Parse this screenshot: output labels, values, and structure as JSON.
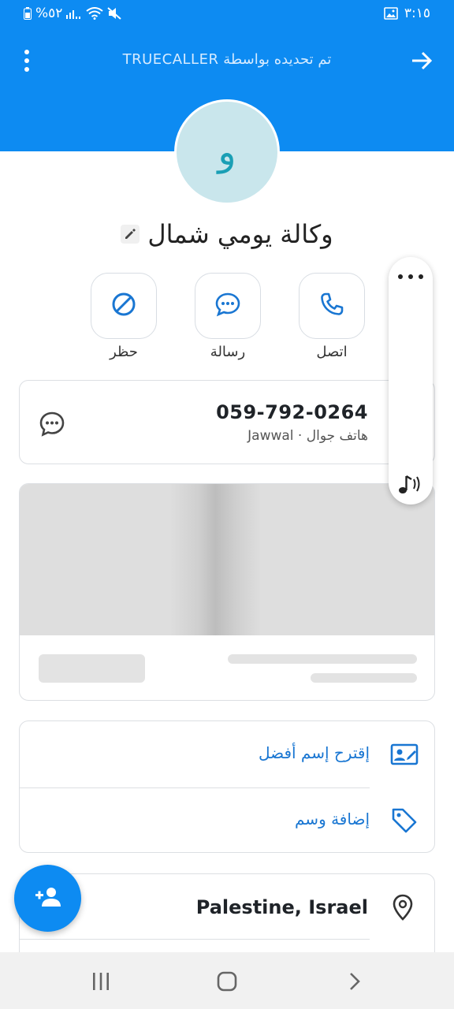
{
  "status_bar": {
    "time": "٣:١٥",
    "battery_text": "%٥٢"
  },
  "header": {
    "updated_by": "تم تحديده بواسطة TRUECALLER"
  },
  "contact": {
    "avatar_letter": "و",
    "name": "وكالة يومي شمال"
  },
  "actions": {
    "call": "اتصل",
    "message": "رسالة",
    "block": "حظر"
  },
  "phone": {
    "number": "059-792-0264",
    "detail": "هاتف جوال · Jawwal"
  },
  "list": {
    "suggest_name": "إقترح إسم أفضل",
    "add_tag": "إضافة وسم"
  },
  "location": {
    "text": "Palestine, Israel"
  },
  "colors": {
    "brand_blue": "#0d8bf2",
    "link_blue": "#1976d2",
    "avatar_bg": "#c9e6ec",
    "avatar_text": "#1a9fb5"
  }
}
